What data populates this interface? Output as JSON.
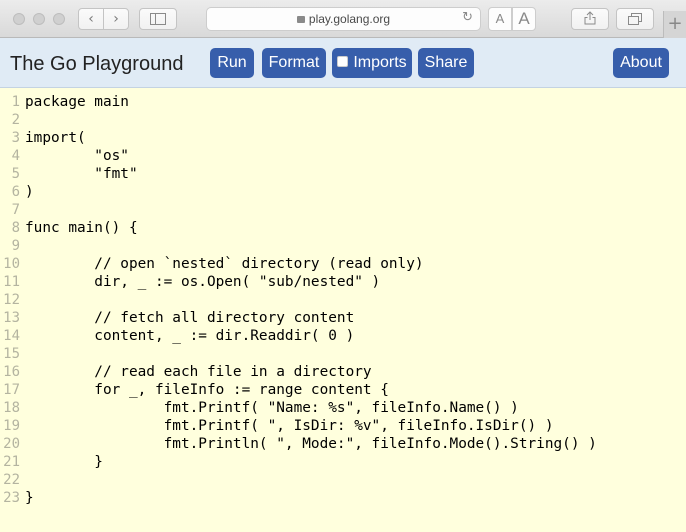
{
  "browser": {
    "url": "play.golang.org",
    "back_glyph": "‹",
    "forward_glyph": "›",
    "reload_glyph": "↻",
    "font_small": "A",
    "font_large": "A",
    "new_tab_glyph": "+"
  },
  "header": {
    "title": "The Go Playground",
    "run_label": "Run",
    "format_label": "Format",
    "imports_label": "Imports",
    "imports_checked": false,
    "share_label": "Share",
    "about_label": "About"
  },
  "colors": {
    "editor_bg": "#ffffdd",
    "header_bg": "#e0ebf5",
    "button_bg": "#375eab"
  },
  "editor": {
    "lines": [
      {
        "n": "1",
        "text": "package main"
      },
      {
        "n": "2",
        "text": ""
      },
      {
        "n": "3",
        "text": "import("
      },
      {
        "n": "4",
        "text": "        \"os\""
      },
      {
        "n": "5",
        "text": "        \"fmt\""
      },
      {
        "n": "6",
        "text": ")"
      },
      {
        "n": "7",
        "text": ""
      },
      {
        "n": "8",
        "text": "func main() {"
      },
      {
        "n": "9",
        "text": ""
      },
      {
        "n": "10",
        "text": "        // open `nested` directory (read only)"
      },
      {
        "n": "11",
        "text": "        dir, _ := os.Open( \"sub/nested\" )"
      },
      {
        "n": "12",
        "text": ""
      },
      {
        "n": "13",
        "text": "        // fetch all directory content"
      },
      {
        "n": "14",
        "text": "        content, _ := dir.Readdir( 0 )"
      },
      {
        "n": "15",
        "text": ""
      },
      {
        "n": "16",
        "text": "        // read each file in a directory"
      },
      {
        "n": "17",
        "text": "        for _, fileInfo := range content {"
      },
      {
        "n": "18",
        "text": "                fmt.Printf( \"Name: %s\", fileInfo.Name() )"
      },
      {
        "n": "19",
        "text": "                fmt.Printf( \", IsDir: %v\", fileInfo.IsDir() )"
      },
      {
        "n": "20",
        "text": "                fmt.Println( \", Mode:\", fileInfo.Mode().String() )"
      },
      {
        "n": "21",
        "text": "        }"
      },
      {
        "n": "22",
        "text": ""
      },
      {
        "n": "23",
        "text": "}"
      }
    ]
  }
}
